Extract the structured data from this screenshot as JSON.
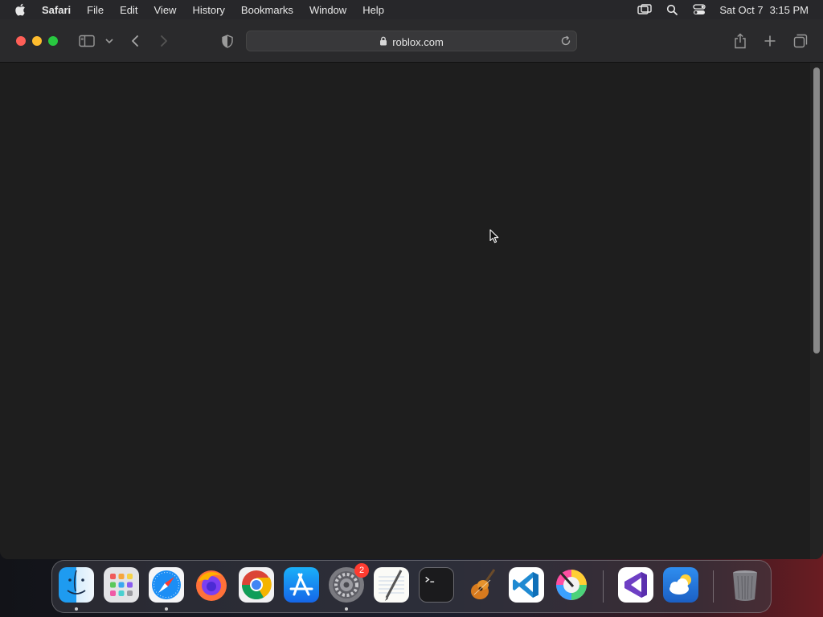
{
  "menubar": {
    "apple_icon": "apple-logo-icon",
    "app_name": "Safari",
    "items": [
      "File",
      "Edit",
      "View",
      "History",
      "Bookmarks",
      "Window",
      "Help"
    ],
    "status_icons": [
      "screen-mirroring-icon",
      "spotlight-search-icon",
      "control-center-icon"
    ],
    "date": "Sat Oct 7",
    "time": "3:15 PM"
  },
  "toolbar": {
    "icons": [
      "sidebar-icon",
      "chevron-down-icon",
      "back-icon",
      "forward-icon",
      "privacy-shield-icon",
      "share-icon",
      "new-tab-icon",
      "tab-overview-icon"
    ],
    "address": {
      "lock_icon": "lock-icon",
      "url": "roblox.com",
      "reload_icon": "reload-icon"
    }
  },
  "dock": {
    "apps": [
      "Finder",
      "Launchpad",
      "Safari",
      "Firefox",
      "Chrome",
      "App Store",
      "System Settings",
      "TextEdit",
      "Terminal",
      "GarageBand",
      "Visual Studio Code",
      "Pixelmator",
      "Visual Studio",
      "Weather",
      "Trash"
    ],
    "badge": "2",
    "running_indicators": [
      "Finder",
      "Safari",
      "System Settings"
    ]
  },
  "colors": {
    "menubar_bg": "#27272a",
    "toolbar_bg": "#2a2a2c",
    "content_bg": "#1e1e1e",
    "close": "#ff5f57",
    "minimize": "#febc2e",
    "maximize": "#28c840",
    "badge": "#ff3b30"
  }
}
